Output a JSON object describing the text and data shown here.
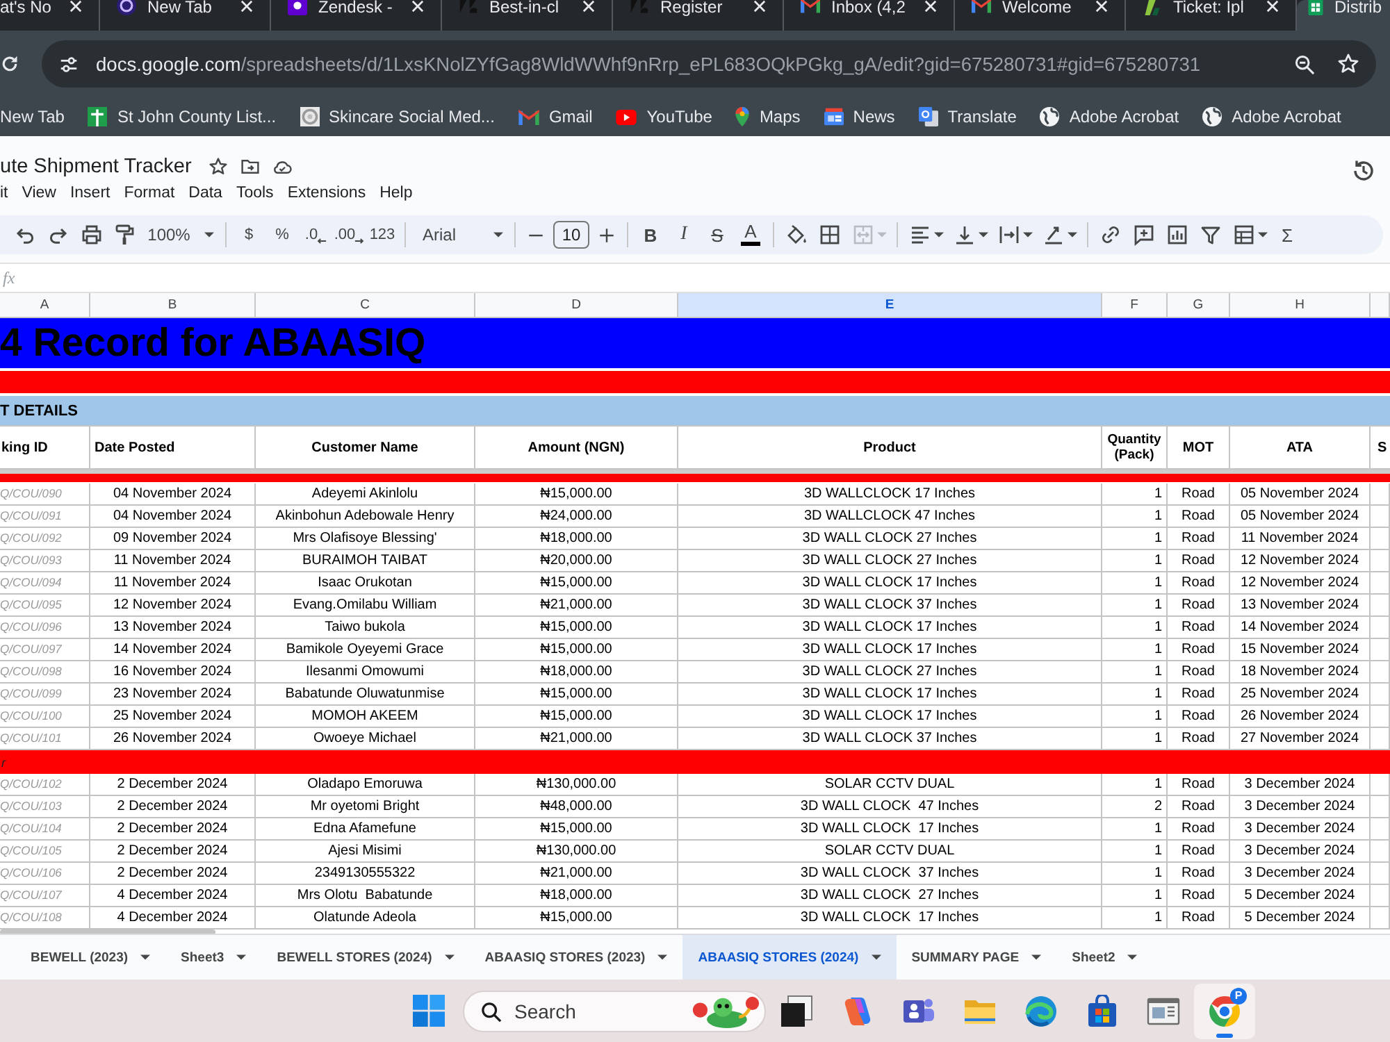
{
  "browser": {
    "tabs": [
      {
        "title": "at's No",
        "kind": "plain",
        "selected": false
      },
      {
        "title": "New Tab",
        "kind": "orb",
        "selected": false
      },
      {
        "title": "Zendesk -",
        "kind": "tile",
        "selected": false
      },
      {
        "title": "Best-in-cl",
        "kind": "shapes",
        "selected": false
      },
      {
        "title": "Register",
        "kind": "shapes",
        "selected": false
      },
      {
        "title": "Inbox (4,2",
        "kind": "mail",
        "selected": false
      },
      {
        "title": "Welcome",
        "kind": "mail",
        "selected": false
      },
      {
        "title": "Ticket: Ipl",
        "kind": "slash",
        "selected": false
      },
      {
        "title": "Distrib",
        "kind": "sheet",
        "selected": true
      }
    ],
    "address": {
      "host": "docs.google.com",
      "path": "/spreadsheets/d/1LxsKNolZYfGag8WldWWhf9nRrp_ePL683OQkPGkg_gA/edit?gid=675280731#gid=675280731"
    },
    "bookmarks": [
      {
        "label": "New Tab",
        "kind": "plain"
      },
      {
        "label": "St John County List...",
        "kind": "sheet"
      },
      {
        "label": "Skincare Social Med...",
        "kind": "disc"
      },
      {
        "label": "Gmail",
        "kind": "mail"
      },
      {
        "label": "YouTube",
        "kind": "video"
      },
      {
        "label": "Maps",
        "kind": "pin"
      },
      {
        "label": "News",
        "kind": "news"
      },
      {
        "label": "Translate",
        "kind": "tiles"
      },
      {
        "label": "Adobe Acrobat",
        "kind": "globe"
      },
      {
        "label": "Adobe Acrobat",
        "kind": "globe"
      }
    ]
  },
  "document": {
    "title": "ute Shipment Tracker",
    "menu": [
      "it",
      "View",
      "Insert",
      "Format",
      "Data",
      "Tools",
      "Extensions",
      "Help"
    ]
  },
  "toolbar": {
    "zoom": "100%",
    "number_formats": [
      {
        "label": "$",
        "kind": "plain"
      },
      {
        "label": "%",
        "kind": "plain"
      },
      {
        "label": ".0",
        "kind": "decrease"
      },
      {
        "label": ".00",
        "kind": "increase"
      },
      {
        "label": "123",
        "kind": "plain"
      }
    ],
    "font": "Arial",
    "font_size": "10",
    "text_styles": [
      {
        "label": "B",
        "kind": "bold"
      },
      {
        "label": "I",
        "kind": "italic"
      },
      {
        "label": "S",
        "kind": "strike"
      },
      {
        "label": "A",
        "kind": "color"
      }
    ],
    "merge": {
      "disabled": true
    },
    "function": "Σ"
  },
  "formula_bar": {
    "label": "fx"
  },
  "sheet": {
    "columns": [
      {
        "label": "A",
        "selected": false
      },
      {
        "label": "B",
        "selected": false
      },
      {
        "label": "C",
        "selected": false
      },
      {
        "label": "D",
        "selected": false
      },
      {
        "label": "E",
        "selected": true
      },
      {
        "label": "F",
        "selected": false
      },
      {
        "label": "G",
        "selected": false
      },
      {
        "label": "H",
        "selected": false
      }
    ],
    "title": "4 Record for ABAASIQ",
    "section": "T DETAILS",
    "headers": [
      "king ID",
      "Date Posted",
      "Customer Name",
      "Amount (NGN)",
      "Product",
      "Quantity (Pack)",
      "MOT",
      "ATA",
      "S"
    ],
    "groups": [
      {
        "rows": [
          [
            "Q/COU/090",
            "04 November 2024",
            "Adeyemi Akinlolu",
            "₦15,000.00",
            "3D WALLCLOCK 17 Inches",
            "1",
            "Road",
            "05 November 2024"
          ],
          [
            "Q/COU/091",
            "04 November 2024",
            "Akinbohun Adebowale Henry",
            "₦24,000.00",
            "3D WALLCLOCK 47 Inches",
            "1",
            "Road",
            "05 November 2024"
          ],
          [
            "Q/COU/092",
            "09 November 2024",
            "Mrs Olafisoye Blessing'",
            "₦18,000.00",
            "3D WALL CLOCK 27 Inches",
            "1",
            "Road",
            "11 November 2024"
          ],
          [
            "Q/COU/093",
            "11 November 2024",
            "BURAIMOH TAIBAT",
            "₦20,000.00",
            "3D WALL CLOCK 27 Inches",
            "1",
            "Road",
            "12 November 2024"
          ],
          [
            "Q/COU/094",
            "11 November 2024",
            "Isaac Orukotan",
            "₦15,000.00",
            "3D WALL CLOCK 17 Inches",
            "1",
            "Road",
            "12 November 2024"
          ],
          [
            "Q/COU/095",
            "12 November 2024",
            "Evang.Omilabu William",
            "₦21,000.00",
            "3D WALL CLOCK 37 Inches",
            "1",
            "Road",
            "13 November 2024"
          ],
          [
            "Q/COU/096",
            "13 November 2024",
            "Taiwo bukola",
            "₦15,000.00",
            "3D WALL CLOCK 17 Inches",
            "1",
            "Road",
            "14 November 2024"
          ],
          [
            "Q/COU/097",
            "14 November 2024",
            "Bamikole Oyeyemi Grace",
            "₦15,000.00",
            "3D WALL CLOCK 17 Inches",
            "1",
            "Road",
            "15 November 2024"
          ],
          [
            "Q/COU/098",
            "16 November 2024",
            "Ilesanmi Omowumi",
            "₦18,000.00",
            "3D WALL CLOCK 27 Inches",
            "1",
            "Road",
            "18 November 2024"
          ],
          [
            "Q/COU/099",
            "23 November 2024",
            "Babatunde Oluwatunmise",
            "₦15,000.00",
            "3D WALL CLOCK 17 Inches",
            "1",
            "Road",
            "25 November 2024"
          ],
          [
            "Q/COU/100",
            "25 November 2024",
            "MOMOH AKEEM",
            "₦15,000.00",
            "3D WALL CLOCK 17 Inches",
            "1",
            "Road",
            "26 November 2024"
          ],
          [
            "Q/COU/101",
            "26 November 2024",
            "Owoeye Michael",
            "₦21,000.00",
            "3D WALL CLOCK 37 Inches",
            "1",
            "Road",
            "27 November 2024"
          ]
        ]
      },
      {
        "label": "r",
        "rows": [
          [
            "Q/COU/102",
            "2 December 2024",
            "Oladapo Emoruwa",
            "₦130,000.00",
            "SOLAR CCTV DUAL",
            "1",
            "Road",
            "3 December 2024"
          ],
          [
            "Q/COU/103",
            "2 December 2024",
            "Mr oyetomi Bright",
            "₦48,000.00",
            "3D WALL CLOCK  47 Inches",
            "2",
            "Road",
            "3 December 2024"
          ],
          [
            "Q/COU/104",
            "2 December 2024",
            "Edna Afamefune",
            "₦15,000.00",
            "3D WALL CLOCK  17 Inches",
            "1",
            "Road",
            "3 December 2024"
          ],
          [
            "Q/COU/105",
            "2 December 2024",
            "Ajesi Misimi",
            "₦130,000.00",
            "SOLAR CCTV DUAL",
            "1",
            "Road",
            "3 December 2024"
          ],
          [
            "Q/COU/106",
            "2 December 2024",
            "2349130555322",
            "₦21,000.00",
            "3D WALL CLOCK  37 Inches",
            "1",
            "Road",
            "3 December 2024"
          ],
          [
            "Q/COU/107",
            "4 December 2024",
            "Mrs Olotu  Babatunde",
            "₦18,000.00",
            "3D WALL CLOCK  27 Inches",
            "1",
            "Road",
            "5 December 2024"
          ],
          [
            "Q/COU/108",
            "4 December 2024",
            "Olatunde Adeola",
            "₦15,000.00",
            "3D WALL CLOCK  17 Inches",
            "1",
            "Road",
            "5 December 2024"
          ]
        ]
      }
    ]
  },
  "sheet_tabs": [
    {
      "label": "BEWELL (2023)",
      "selected": false
    },
    {
      "label": "Sheet3",
      "selected": false
    },
    {
      "label": "BEWELL STORES (2024)",
      "selected": false
    },
    {
      "label": "ABAASIQ STORES (2023)",
      "selected": false
    },
    {
      "label": "ABAASIQ STORES (2024)",
      "selected": true
    },
    {
      "label": "SUMMARY PAGE",
      "selected": false
    },
    {
      "label": "Sheet2",
      "selected": false
    }
  ],
  "taskbar": {
    "search": {
      "placeholder": "Search"
    },
    "profile_badge": "P"
  }
}
